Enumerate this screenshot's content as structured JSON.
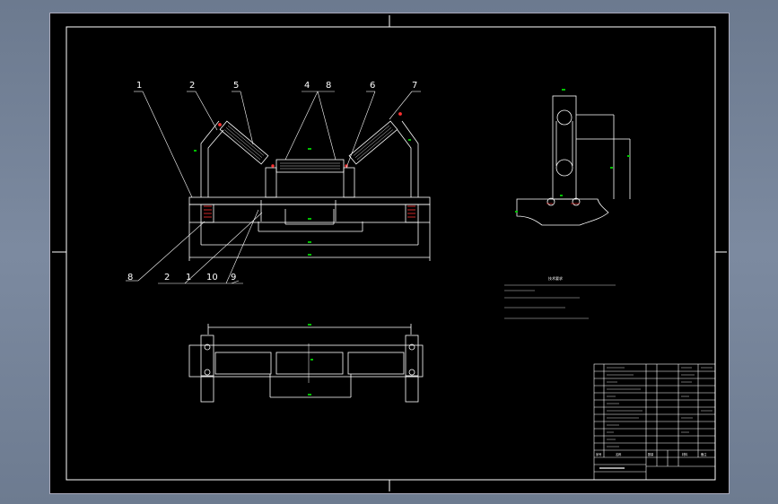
{
  "title": "",
  "part_labels": {
    "top": [
      "1",
      "2",
      "5",
      "4",
      "8",
      "6",
      "7"
    ],
    "bottom": [
      "8",
      "2",
      "1",
      "10",
      "9"
    ]
  },
  "notes_heading": "技术要求",
  "title_block": {
    "header": [
      "序号",
      "名称",
      "数量",
      "材料",
      "备注"
    ]
  },
  "colors": {
    "line": "#ffffff",
    "dimension": "#00c000",
    "section": "#ff3030",
    "background": "#000000"
  }
}
